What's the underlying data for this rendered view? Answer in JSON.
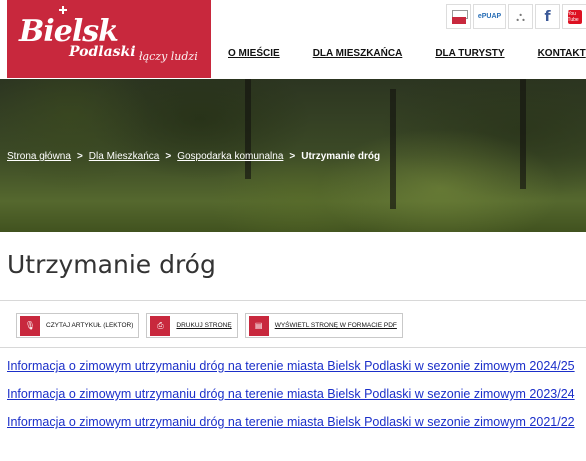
{
  "logo": {
    "main": "Bielsk",
    "sub": "Podlaski",
    "tagline": "łączy ludzi"
  },
  "top_icons": [
    {
      "name": "bip-icon",
      "label": "BIP"
    },
    {
      "name": "epuap-icon",
      "label": "ePUAP"
    },
    {
      "name": "sitemap-icon",
      "label": ""
    },
    {
      "name": "facebook-icon",
      "label": "f"
    },
    {
      "name": "youtube-icon",
      "label": "You Tube"
    }
  ],
  "nav": {
    "items": [
      "O MIEŚCIE",
      "DLA MIESZKAŃCA",
      "DLA TURYSTY",
      "KONTAKT"
    ]
  },
  "breadcrumb": {
    "items": [
      "Strona główna",
      "Dla Mieszkańca",
      "Gospodarka komunalna"
    ],
    "separator": ">",
    "current": "Utrzymanie dróg"
  },
  "page": {
    "title": "Utrzymanie dróg"
  },
  "tools": [
    {
      "label": "CZYTAJ ARTYKUŁ (LEKTOR)",
      "icon": "microphone-icon"
    },
    {
      "label": "DRUKUJ STRONĘ",
      "icon": "printer-icon"
    },
    {
      "label": "WYŚWIETL STRONĘ W FORMACIE PDF",
      "icon": "pdf-icon"
    }
  ],
  "links": [
    "Informacja o zimowym utrzymaniu dróg na terenie miasta Bielsk Podlaski w sezonie zimowym 2024/25",
    "Informacja o zimowym utrzymaniu dróg na terenie miasta Bielsk Podlaski w sezonie zimowym 2023/24",
    "Informacja o zimowym utrzymaniu dróg na terenie miasta Bielsk Podlaski w sezonie zimowym 2021/22"
  ],
  "colors": {
    "brand": "#c8283d",
    "link": "#1b2fc9"
  }
}
